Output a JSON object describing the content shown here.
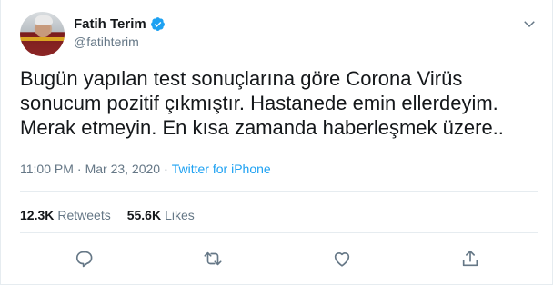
{
  "user": {
    "display_name": "Fatih Terim",
    "handle": "@fatihterim",
    "verified": true
  },
  "tweet": {
    "text": "Bugün yapılan test sonuçlarına göre Corona Virüs\nsonucum pozitif çıkmıştır. Hastanede emin ellerdeyim.\nMerak etmeyin. En kısa zamanda haberleşmek üzere..",
    "time": "11:00 PM",
    "separator": "·",
    "date": "Mar 23, 2020",
    "source": "Twitter for iPhone"
  },
  "stats": {
    "retweets_count": "12.3K",
    "retweets_label": "Retweets",
    "likes_count": "55.6K",
    "likes_label": "Likes"
  },
  "icons": {
    "verified": "verified-badge-icon",
    "menu": "chevron-down-icon",
    "reply": "reply-icon",
    "retweet": "retweet-icon",
    "like": "heart-icon",
    "share": "share-icon"
  },
  "colors": {
    "accent": "#1da1f2",
    "text": "#14171a",
    "secondary": "#657786",
    "border": "#e6ecf0"
  }
}
